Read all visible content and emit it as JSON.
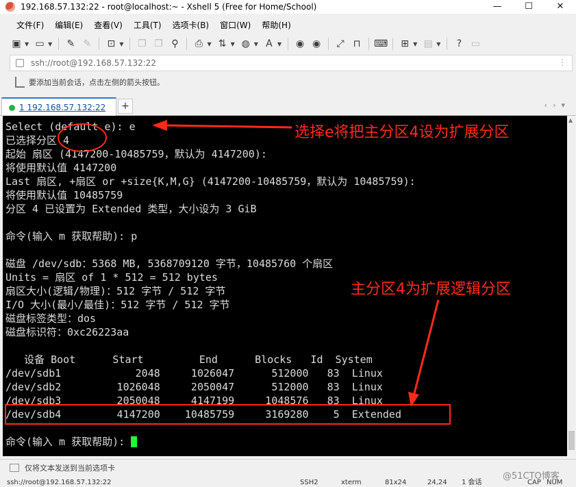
{
  "window": {
    "title": "192.168.57.132:22 - root@localhost:~ - Xshell 5 (Free for Home/School)",
    "controls": [
      "—",
      "☐",
      "✕"
    ]
  },
  "menu": [
    "文件(F)",
    "编辑(E)",
    "查看(V)",
    "工具(T)",
    "选项卡(B)",
    "窗口(W)",
    "帮助(H)"
  ],
  "address": {
    "value": "ssh://root@192.168.57.132:22"
  },
  "hint": {
    "text": "要添加当前会话，点击左侧的箭头按钮。"
  },
  "tab": {
    "index": "1",
    "label": "192.168.57.132:22",
    "add": "+"
  },
  "terminal": {
    "lines": [
      "Select (default e): e",
      "已选择分区 4",
      "起始 扇区 (4147200-10485759，默认为 4147200):",
      "将使用默认值 4147200",
      "Last 扇区, +扇区 or +size{K,M,G} (4147200-10485759，默认为 10485759):",
      "将使用默认值 10485759",
      "分区 4 已设置为 Extended 类型，大小设为 3 GiB",
      "",
      "命令(输入 m 获取帮助): p",
      "",
      "磁盘 /dev/sdb：5368 MB, 5368709120 字节，10485760 个扇区",
      "Units = 扇区 of 1 * 512 = 512 bytes",
      "扇区大小(逻辑/物理)：512 字节 / 512 字节",
      "I/O 大小(最小/最佳)：512 字节 / 512 字节",
      "磁盘标签类型：dos",
      "磁盘标识符：0xc26223aa",
      "",
      "   设备 Boot      Start         End      Blocks   Id  System",
      "/dev/sdb1            2048     1026047      512000   83  Linux",
      "/dev/sdb2         1026048     2050047      512000   83  Linux",
      "/dev/sdb3         2050048     4147199     1048576   83  Linux",
      "/dev/sdb4         4147200    10485759     3169280    5  Extended",
      "",
      "命令(输入 m 获取帮助): "
    ]
  },
  "annotations": {
    "top": "选择e将把主分区4设为扩展分区",
    "middle": "主分区4为扩展逻辑分区",
    "color": "#ff2a1a"
  },
  "compose": {
    "placeholder": "仅将文本发送到当前选项卡"
  },
  "status": {
    "session": "ssh://root@192.168.57.132:22",
    "protocol": "SSH2",
    "term": "xterm",
    "size": "81x24",
    "cursor": "24,24",
    "sessions": "1 会话",
    "caps": "CAP",
    "num": "NUM"
  },
  "watermark": "@51CTO博客",
  "icons": [
    "new-session-icon",
    "open-folder-icon",
    "link-icon",
    "unlink-icon",
    "properties-icon",
    "copy-icon",
    "paste-icon",
    "find-icon",
    "print-icon",
    "transfer-icon",
    "globe-icon",
    "font-icon",
    "xftp-icon",
    "xmanager-icon",
    "fullscreen-icon",
    "lock-icon",
    "keyboard-icon",
    "add-icon",
    "layout-icon",
    "help-icon",
    "chat-icon"
  ]
}
